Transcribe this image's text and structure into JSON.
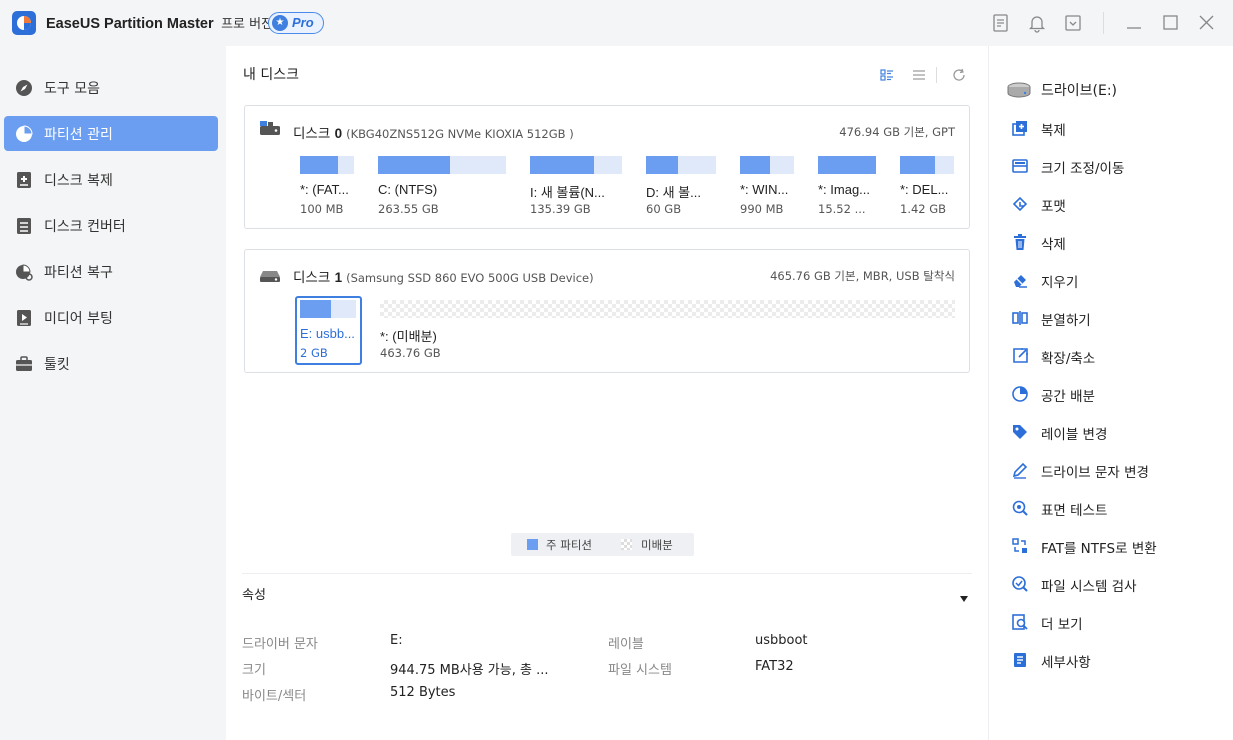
{
  "app": {
    "title": "EaseUS Partition Master",
    "edition": "프로 버전",
    "badge": "Pro"
  },
  "titlebar_icons": [
    "notes-icon",
    "bell-icon",
    "dropdown-box-icon",
    "minimize-icon",
    "maximize-icon",
    "close-icon"
  ],
  "sidebar": {
    "items": [
      {
        "label": "도구 모음",
        "icon": "compass-icon"
      },
      {
        "label": "파티션 관리",
        "icon": "pie-icon",
        "active": true
      },
      {
        "label": "디스크 복제",
        "icon": "clone-plus-icon"
      },
      {
        "label": "디스크 컨버터",
        "icon": "disk-convert-icon"
      },
      {
        "label": "파티션 복구",
        "icon": "recover-icon"
      },
      {
        "label": "미디어 부팅",
        "icon": "media-boot-icon"
      },
      {
        "label": "툴킷",
        "icon": "toolbox-icon"
      }
    ]
  },
  "main": {
    "title": "내 디스크",
    "disks": [
      {
        "name_prefix": "디스크",
        "number": "0",
        "model": "(KBG40ZNS512G NVMe KIOXIA 512GB )",
        "info": "476.94 GB 기본, GPT",
        "partitions": [
          {
            "label": "*: (FAT...",
            "size": "100 MB",
            "used": 0.7
          },
          {
            "label": "C: (NTFS)",
            "size": "263.55 GB",
            "used": 0.56
          },
          {
            "label": "I: 새 볼륨(N...",
            "size": "135.39 GB",
            "used": 0.7
          },
          {
            "label": "D: 새 볼...",
            "size": "60 GB",
            "used": 0.45
          },
          {
            "label": "*: WIN...",
            "size": "990 MB",
            "used": 0.55
          },
          {
            "label": "*: Imag...",
            "size": "15.52 ...",
            "used": 1.0
          },
          {
            "label": "*: DEL...",
            "size": "1.42 GB",
            "used": 0.65
          }
        ]
      },
      {
        "name_prefix": "디스크",
        "number": "1",
        "model": "(Samsung  SSD 860 EVO 500G USB Device)",
        "info": "465.76 GB 기본, MBR, USB 탈착식",
        "partitions": [
          {
            "label": "E: usbb...",
            "size": "2 GB",
            "used": 0.55,
            "selected": true
          },
          {
            "label": "*: (미배분)",
            "size": "463.76 GB",
            "unallocated": true
          }
        ]
      }
    ],
    "legend": {
      "primary": "주 파티션",
      "unallocated": "미배분"
    },
    "properties": {
      "title": "속성",
      "items": [
        {
          "key": "드라이버 문자",
          "value": "E:"
        },
        {
          "key": "레이블",
          "value": "usbboot"
        },
        {
          "key": "크기",
          "value": "944.75 MB사용 가능, 총 ..."
        },
        {
          "key": "파일 시스템",
          "value": "FAT32"
        },
        {
          "key": "바이트/섹터",
          "value": "512 Bytes"
        }
      ]
    }
  },
  "right_panel": {
    "drive_label": "드라이브(E:)",
    "actions": [
      {
        "label": "복제",
        "icon": "clone-icon"
      },
      {
        "label": "크기 조정/이동",
        "icon": "resize-icon"
      },
      {
        "label": "포맷",
        "icon": "format-icon"
      },
      {
        "label": "삭제",
        "icon": "trash-icon"
      },
      {
        "label": "지우기",
        "icon": "eraser-icon"
      },
      {
        "label": "분열하기",
        "icon": "split-icon"
      },
      {
        "label": "확장/축소",
        "icon": "extend-icon"
      },
      {
        "label": "공간 배분",
        "icon": "allocate-icon"
      },
      {
        "label": "레이블 변경",
        "icon": "tag-icon"
      },
      {
        "label": "드라이브 문자 변경",
        "icon": "pen-icon"
      },
      {
        "label": "표면 테스트",
        "icon": "surface-test-icon"
      },
      {
        "label": "FAT를 NTFS로 변환",
        "icon": "convert-icon"
      },
      {
        "label": "파일 시스템 검사",
        "icon": "fs-check-icon"
      },
      {
        "label": "더 보기",
        "icon": "browse-icon"
      },
      {
        "label": "세부사항",
        "icon": "details-icon"
      }
    ]
  },
  "colors": {
    "accent": "#6b9ef0",
    "accent_dark": "#3f7fe0",
    "partition_bg": "#e0e9f9"
  }
}
